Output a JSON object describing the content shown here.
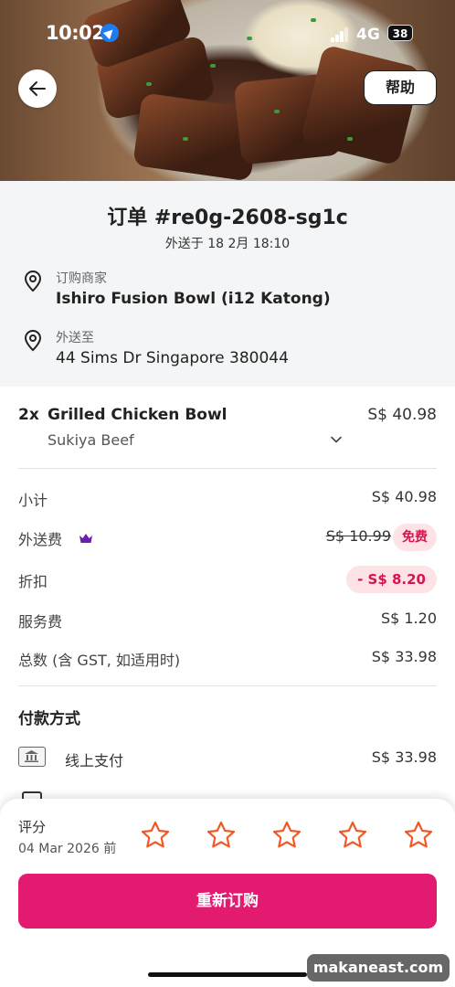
{
  "status_bar": {
    "time": "10:02",
    "network": "4G",
    "battery": "38"
  },
  "header": {
    "help_label": "帮助"
  },
  "order": {
    "title": "订单 #re0g-2608-sg1c",
    "delivered_at": "外送于 18 2月 18:10",
    "vendor_label": "订购商家",
    "vendor_name": "Ishiro Fusion Bowl (i12 Katong)",
    "address_label": "外送至",
    "address": "44 Sims Dr Singapore 380044"
  },
  "items": [
    {
      "qty": "2x",
      "name": "Grilled Chicken Bowl",
      "variant": "Sukiya Beef",
      "price": "S$ 40.98"
    }
  ],
  "summary": {
    "subtotal_label": "小计",
    "subtotal": "S$ 40.98",
    "delivery_label": "外送费",
    "delivery_original": "S$ 10.99",
    "delivery_badge": "免费",
    "discount_label": "折扣",
    "discount": "- S$ 8.20",
    "service_label": "服务费",
    "service": "S$ 1.20",
    "total_label": "总数 (含 GST, 如适用时)",
    "total": "S$ 33.98"
  },
  "payment": {
    "title": "付款方式",
    "method": "线上支付",
    "amount": "S$ 33.98"
  },
  "rating": {
    "label": "评分",
    "deadline": "04 Mar 2026 前",
    "stars": 5
  },
  "actions": {
    "reorder_label": "重新订购"
  },
  "watermark": "makaneast.com",
  "colors": {
    "brand": "#e21b70",
    "star": "#f05a28",
    "badge_bg": "#fde2e6",
    "badge_text": "#d6144f",
    "crown": "#6b1fb0"
  }
}
